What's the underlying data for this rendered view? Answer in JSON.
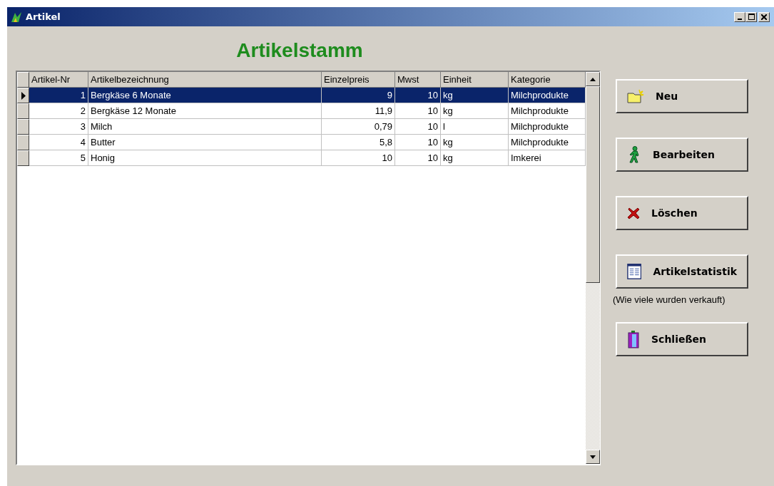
{
  "window": {
    "title": "Artikel"
  },
  "heading": "Artikelstamm",
  "table": {
    "columns": [
      "Artikel-Nr",
      "Artikelbezeichnung",
      "Einzelpreis",
      "Mwst",
      "Einheit",
      "Kategorie"
    ],
    "rows": [
      {
        "selected": true,
        "cells": [
          "1",
          "Bergkäse 6 Monate",
          "9",
          "10",
          "kg",
          "Milchprodukte"
        ]
      },
      {
        "selected": false,
        "cells": [
          "2",
          "Bergkäse 12 Monate",
          "11,9",
          "10",
          "kg",
          "Milchprodukte"
        ]
      },
      {
        "selected": false,
        "cells": [
          "3",
          "Milch",
          "0,79",
          "10",
          "l",
          "Milchprodukte"
        ]
      },
      {
        "selected": false,
        "cells": [
          "4",
          "Butter",
          "5,8",
          "10",
          "kg",
          "Milchprodukte"
        ]
      },
      {
        "selected": false,
        "cells": [
          "5",
          "Honig",
          "10",
          "10",
          "kg",
          "Imkerei"
        ]
      }
    ]
  },
  "buttons": [
    {
      "kind": "new",
      "label": "Neu"
    },
    {
      "kind": "edit",
      "label": "Bearbeiten"
    },
    {
      "kind": "delete",
      "label": "Löschen"
    },
    {
      "kind": "stats",
      "label": "Artikelstatistik",
      "note": "(Wie viele wurden verkauft)"
    },
    {
      "kind": "close",
      "label": "Schließen"
    }
  ]
}
